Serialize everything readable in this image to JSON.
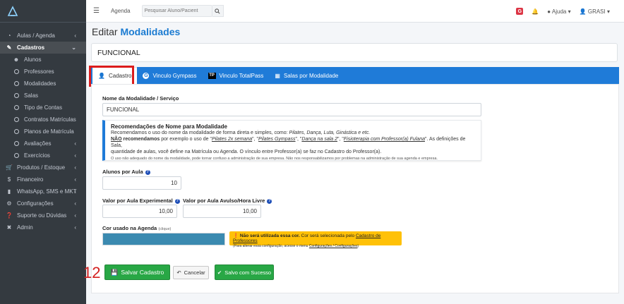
{
  "topbar": {
    "menu_label": "Agenda",
    "search_placeholder": "Pesquisar Aluno/Pacient",
    "badge": "G",
    "help_label": "Ajuda",
    "user_label": "GRASI"
  },
  "sidebar": {
    "items": [
      {
        "label": "Aulas / Agenda",
        "icon": "dashboard-icon",
        "arrow": "‹"
      },
      {
        "label": "Cadastros",
        "icon": "edit-icon",
        "arrow": "⌄"
      },
      {
        "label": "Alunos",
        "icon": "users-icon"
      },
      {
        "label": "Professores",
        "icon": "circle-icon"
      },
      {
        "label": "Modalidades",
        "icon": "circle-icon"
      },
      {
        "label": "Salas",
        "icon": "circle-icon"
      },
      {
        "label": "Tipo de Contas",
        "icon": "circle-icon"
      },
      {
        "label": "Contratos Matrículas",
        "icon": "circle-icon"
      },
      {
        "label": "Planos de Matrícula",
        "icon": "circle-icon"
      },
      {
        "label": "Avaliações",
        "icon": "circle-icon",
        "arrow": "‹"
      },
      {
        "label": "Exercícios",
        "icon": "circle-icon",
        "arrow": "‹"
      },
      {
        "label": "Produtos / Estoque",
        "icon": "cart-icon",
        "arrow": "‹"
      },
      {
        "label": "Financeiro",
        "icon": "dollar-icon",
        "arrow": "‹"
      },
      {
        "label": "WhatsApp, SMS e MKT",
        "icon": "whatsapp-icon",
        "arrow": "‹"
      },
      {
        "label": "Configurações",
        "icon": "gear-icon",
        "arrow": "‹"
      },
      {
        "label": "Suporte ou Dúvidas",
        "icon": "question-icon",
        "arrow": "‹"
      },
      {
        "label": "Admin",
        "icon": "tools-icon",
        "arrow": "‹"
      }
    ]
  },
  "page": {
    "title_prefix": "Editar",
    "title_highlight": "Modalidades",
    "record_name": "FUNCIONAL"
  },
  "tabs": [
    {
      "label": "Cadastro",
      "icon": "user-edit-icon"
    },
    {
      "label": "Vinculo Gympass",
      "icon": "gympass-icon"
    },
    {
      "label": "Vinculo TotalPass",
      "icon": "totalpass-icon"
    },
    {
      "label": "Salas por Modalidade",
      "icon": "rooms-icon"
    }
  ],
  "form": {
    "name_label": "Nome da Modalidade / Serviço",
    "name_value": "FUNCIONAL",
    "callout": {
      "title": "Recomendações de Nome para Modalidade",
      "line1_a": "Recomendamos o uso do nome da modalidade de forma direta e simples, como: ",
      "line1_b": "Pilates, Dança, Luta, Ginástica e etc.",
      "line2_a": "NÃO",
      "line2_b": " recomendamos",
      "line2_c": " por exemplo o uso de \"",
      "line2_d": "Pilates 2x semana",
      "line2_e": "\", \"",
      "line2_f": "Pilates Gympass",
      "line2_g": "\", \"",
      "line2_h": "Dança na sala 2",
      "line2_i": "\", \"",
      "line2_j": "Fisioterapia com Professor(a) Fulana",
      "line2_k": "\". As definições de Sala,",
      "line3": "quantidade de aulas, você define na Matrícula ou Agenda. O vínculo entre Professor(a) se faz no Cadastro do Professor(a).",
      "small": "O uso não adequado do nome da modalidade, pode tornar confuso a administração de sua empresa. Não nos responsabilizamos por problemas na administração de sua agenda e empresa."
    },
    "students_label": "Alunos por Aula",
    "students_value": "10",
    "trial_label": "Valor por Aula Experimental",
    "trial_value": "10,00",
    "single_label": "Valor por Aula Avulso/Hora Livre",
    "single_value": "10,00",
    "color_label": "Cor usado na Agenda",
    "color_hint": "(clique)",
    "color_value": "#3b8ab0",
    "warn_bold": "Não será utilizada essa cor.",
    "warn_text": " Cor será selecionada pelo ",
    "warn_link": "Cadastro de Professores",
    "warn_line2_a": "(Para alterar essa configuração, acesse o menu ",
    "warn_line2_link": "Configurações / Configurações",
    "warn_line2_b": ")"
  },
  "actions": {
    "step_number": "12",
    "save_label": "Salvar Cadastro",
    "cancel_label": "Cancelar",
    "success_label": "Salvo com Sucesso"
  },
  "colors": {
    "sidebar_bg": "#343a40",
    "tab_bar": "#1f7bd8",
    "success": "#28a745",
    "warning": "#ffc107",
    "highlight": "#dc1c1c"
  }
}
